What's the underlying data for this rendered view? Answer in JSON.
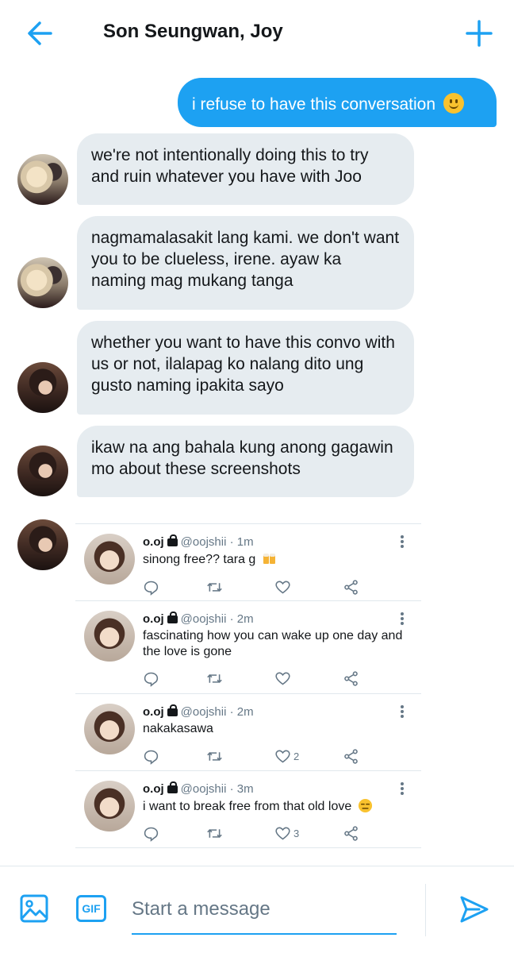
{
  "header": {
    "title": "Son Seungwan, Joy"
  },
  "messages": {
    "sent": "i refuse to have this conversation",
    "received": [
      {
        "text": "we're not intentionally doing this to try and ruin whatever you have with Joo"
      },
      {
        "text": "nagmamalasakit lang kami. we don't want you to be clueless, irene. ayaw ka naming mag mukang tanga"
      },
      {
        "text": "whether you want to have this convo with us or not, ilalapag ko nalang dito ung gusto naming ipakita sayo"
      },
      {
        "text": "ikaw na ang bahala kung anong gagawin mo about these screenshots"
      }
    ]
  },
  "tweets": [
    {
      "name": "o.oj",
      "handle": "@oojshii",
      "time": "· 1m",
      "text": "sinong free?? tara g",
      "likes": ""
    },
    {
      "name": "o.oj",
      "handle": "@oojshii",
      "time": "· 2m",
      "text": "fascinating how you can wake up one day and the love is gone",
      "likes": ""
    },
    {
      "name": "o.oj",
      "handle": "@oojshii",
      "time": "· 2m",
      "text": "nakakasawa",
      "likes": "2"
    },
    {
      "name": "o.oj",
      "handle": "@oojshii",
      "time": "· 3m",
      "text": "i want to break free from that old love",
      "likes": "3"
    }
  ],
  "composer": {
    "placeholder": "Start a message",
    "gif_label": "GIF"
  },
  "colors": {
    "accent": "#1da1f2",
    "bubble": "#e6ecf0",
    "muted": "#657786"
  }
}
